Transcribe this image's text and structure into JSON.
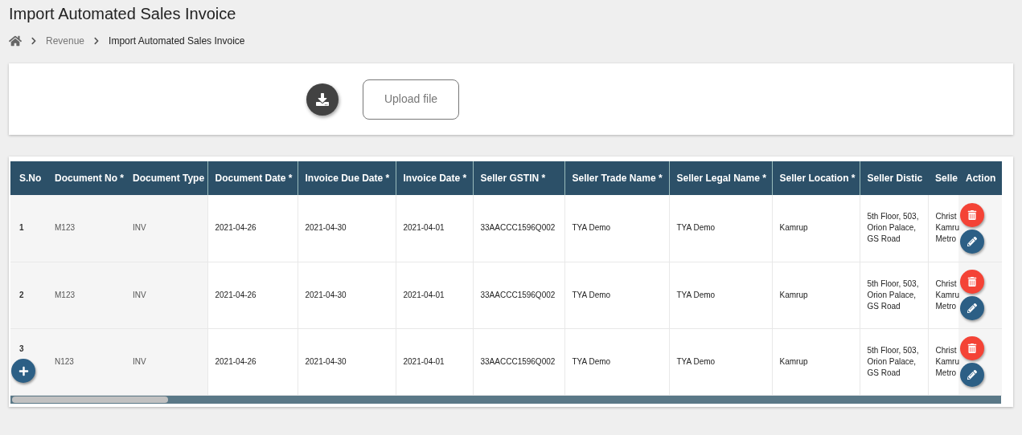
{
  "title": "Import Automated Sales Invoice",
  "breadcrumb": [
    {
      "kind": "home",
      "current": false
    },
    {
      "kind": "link",
      "label": "Revenue",
      "current": false
    },
    {
      "kind": "link",
      "label": "Import Automated Sales Invoice",
      "current": true
    }
  ],
  "upload": {
    "button": "Upload file"
  },
  "table": {
    "columns": [
      "S.No",
      "Document No *",
      "Document Type",
      "Document Date *",
      "Invoice Due Date *",
      "Invoice Date *",
      "Seller GSTIN *",
      "Seller Trade Name *",
      "Seller Legal Name *",
      "Seller Location *",
      "Seller Distic",
      "Selle",
      "Action"
    ],
    "rows": [
      {
        "cells": [
          "1",
          "M123",
          "INV",
          "2021-04-26",
          "2021-04-30",
          "2021-04-01",
          "33AACCC1596Q002",
          "TYA Demo",
          "TYA Demo",
          "Kamrup",
          "5th Floor, 503, Orion Palace, GS Road",
          "Christ\nKamru\nMetro"
        ]
      },
      {
        "cells": [
          "2",
          "M123",
          "INV",
          "2021-04-26",
          "2021-04-30",
          "2021-04-01",
          "33AACCC1596Q002",
          "TYA Demo",
          "TYA Demo",
          "Kamrup",
          "5th Floor, 503, Orion Palace, GS Road",
          "Christ\nKamru\nMetro"
        ]
      },
      {
        "cells": [
          "3",
          "N123",
          "INV",
          "2021-04-26",
          "2021-04-30",
          "2021-04-01",
          "33AACCC1596Q002",
          "TYA Demo",
          "TYA Demo",
          "Kamrup",
          "5th Floor, 503, Orion Palace, GS Road",
          "Christ\nKamru\nMetro"
        ]
      }
    ]
  }
}
